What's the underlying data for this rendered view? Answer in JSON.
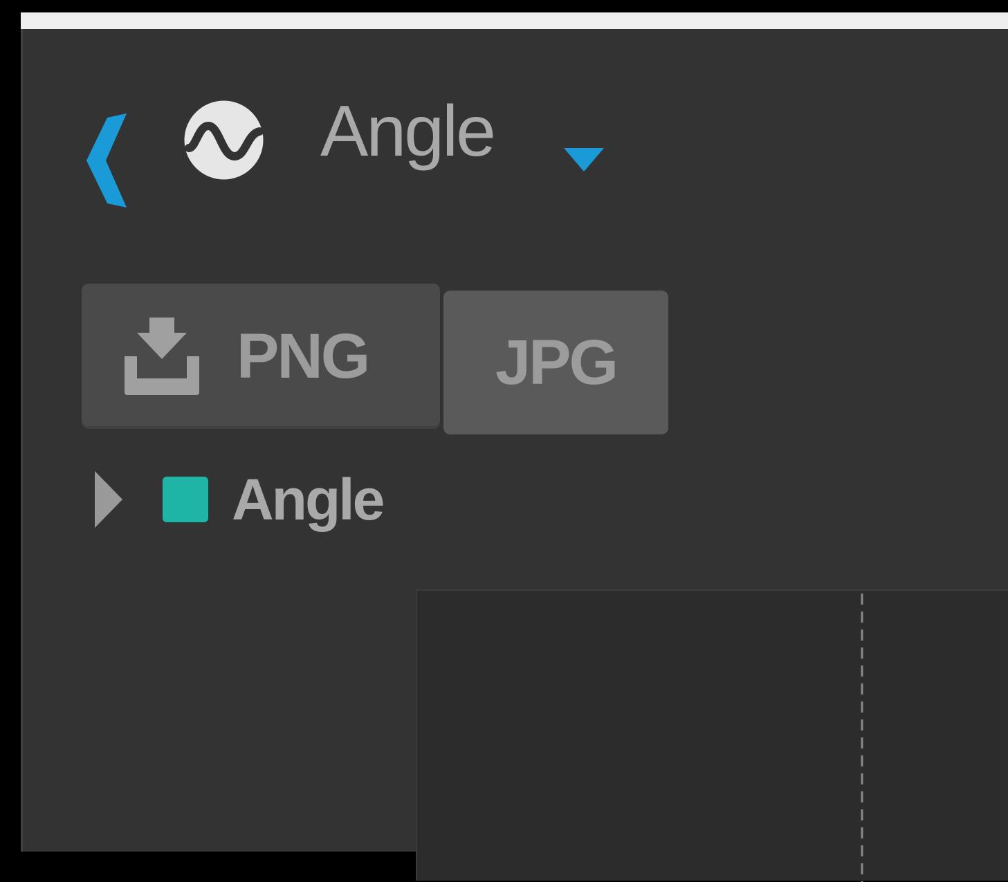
{
  "header": {
    "back_icon": "chevron-left-icon",
    "logo_icon": "waveform-circle-icon",
    "title": "Angle",
    "dropdown_icon": "caret-down-icon",
    "accent_color": "#1a9ad6"
  },
  "export": {
    "png_icon": "download-icon",
    "png_label": "PNG",
    "jpg_label": "JPG"
  },
  "legend": {
    "expand_icon": "triangle-right-icon",
    "series": [
      {
        "label": "Angle",
        "color": "#1fb5a6"
      }
    ]
  },
  "plot": {
    "cursor_style": "dashed"
  }
}
